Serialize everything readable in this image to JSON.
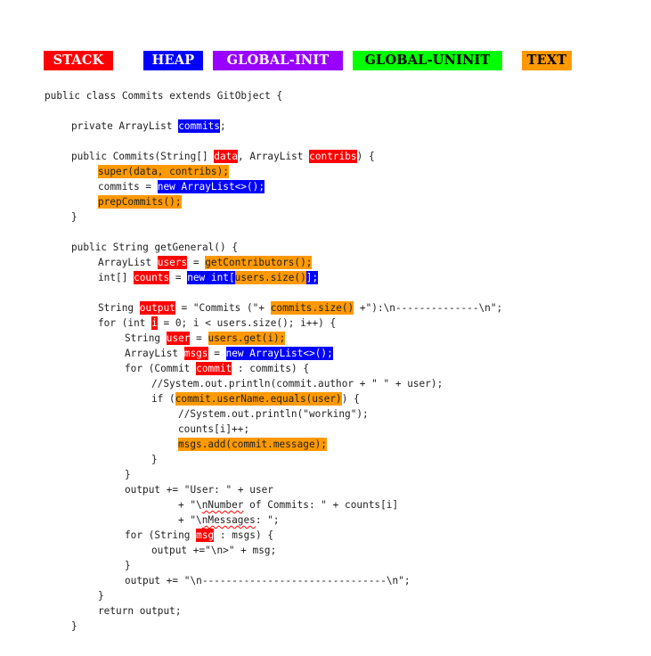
{
  "legend": {
    "stack": {
      "label": "STACK",
      "color": "#ff0000",
      "text_color": "#ffffff"
    },
    "heap": {
      "label": "HEAP",
      "color": "#0000ff",
      "text_color": "#ffffff"
    },
    "global_init": {
      "label": "GLOBAL-INIT",
      "color": "#9900ff",
      "text_color": "#ffffff"
    },
    "global_uninit": {
      "label": "GLOBAL-UNINIT",
      "color": "#00ff00",
      "text_color": "#000000"
    },
    "text": {
      "label": "TEXT",
      "color": "#ff9900",
      "text_color": "#000000"
    }
  },
  "code_lines": [
    {
      "indent": 0,
      "segments": [
        {
          "t": "public class Commits extends GitObject {"
        }
      ]
    },
    {
      "indent": 0,
      "segments": []
    },
    {
      "indent": 1,
      "segments": [
        {
          "t": "private ArrayList "
        },
        {
          "t": "commits",
          "c": "blue"
        },
        {
          "t": ";"
        }
      ]
    },
    {
      "indent": 0,
      "segments": []
    },
    {
      "indent": 1,
      "segments": [
        {
          "t": "public Commits(String[] "
        },
        {
          "t": "data",
          "c": "red"
        },
        {
          "t": ", ArrayList "
        },
        {
          "t": "contribs",
          "c": "red"
        },
        {
          "t": ") {"
        }
      ]
    },
    {
      "indent": 2,
      "segments": [
        {
          "t": "super(data, contribs);",
          "c": "orange"
        }
      ]
    },
    {
      "indent": 2,
      "segments": [
        {
          "t": "commits = "
        },
        {
          "t": "new ArrayList<>();",
          "c": "blue"
        }
      ]
    },
    {
      "indent": 2,
      "segments": [
        {
          "t": "prepCommits();",
          "c": "orange"
        }
      ]
    },
    {
      "indent": 1,
      "segments": [
        {
          "t": "}"
        }
      ]
    },
    {
      "indent": 0,
      "segments": []
    },
    {
      "indent": 1,
      "segments": [
        {
          "t": "public String getGeneral() {"
        }
      ]
    },
    {
      "indent": 2,
      "segments": [
        {
          "t": "ArrayList "
        },
        {
          "t": "users",
          "c": "red"
        },
        {
          "t": " = "
        },
        {
          "t": "getContributors();",
          "c": "orange"
        }
      ]
    },
    {
      "indent": 2,
      "segments": [
        {
          "t": "int[] "
        },
        {
          "t": "counts",
          "c": "red"
        },
        {
          "t": " = "
        },
        {
          "t": "new int[",
          "c": "blue"
        },
        {
          "t": "users.size()",
          "c": "orange"
        },
        {
          "t": "];",
          "c": "blue"
        }
      ]
    },
    {
      "indent": 0,
      "segments": []
    },
    {
      "indent": 2,
      "segments": [
        {
          "t": "String "
        },
        {
          "t": "output",
          "c": "red"
        },
        {
          "t": " = \"Commits (\"+ "
        },
        {
          "t": "commits.size()",
          "c": "orange"
        },
        {
          "t": " +\"):\\n--------------\\n\";"
        }
      ]
    },
    {
      "indent": 2,
      "segments": [
        {
          "t": "for (int "
        },
        {
          "t": "i",
          "c": "red"
        },
        {
          "t": " = 0; i < users.size(); i++) {"
        }
      ]
    },
    {
      "indent": 3,
      "segments": [
        {
          "t": "String "
        },
        {
          "t": "user",
          "c": "red"
        },
        {
          "t": " = "
        },
        {
          "t": "users.get(i);",
          "c": "orange"
        }
      ]
    },
    {
      "indent": 3,
      "segments": [
        {
          "t": "ArrayList "
        },
        {
          "t": "msgs",
          "c": "red"
        },
        {
          "t": " = "
        },
        {
          "t": "new ArrayList<>();",
          "c": "blue"
        }
      ]
    },
    {
      "indent": 3,
      "segments": [
        {
          "t": "for (Commit "
        },
        {
          "t": "commit",
          "c": "red"
        },
        {
          "t": " : commits) {"
        }
      ]
    },
    {
      "indent": 4,
      "segments": [
        {
          "t": "//System.out.println(commit.author + \" \" + user);"
        }
      ]
    },
    {
      "indent": 4,
      "segments": [
        {
          "t": "if ("
        },
        {
          "t": "commit.userName.equals(user)",
          "c": "orange"
        },
        {
          "t": ") {"
        }
      ]
    },
    {
      "indent": 5,
      "segments": [
        {
          "t": "//System.out.println(\"working\");"
        }
      ]
    },
    {
      "indent": 5,
      "segments": [
        {
          "t": "counts[i]++;"
        }
      ]
    },
    {
      "indent": 5,
      "segments": [
        {
          "t": "msgs.add(commit.message);",
          "c": "orange"
        }
      ]
    },
    {
      "indent": 4,
      "segments": [
        {
          "t": "}"
        }
      ]
    },
    {
      "indent": 3,
      "segments": [
        {
          "t": "}"
        }
      ]
    },
    {
      "indent": 3,
      "segments": [
        {
          "t": "output += \"User: \" + user"
        }
      ]
    },
    {
      "indent": 5,
      "segments": [
        {
          "t": "+ \"\\"
        },
        {
          "t": "nNumber",
          "c": "squig"
        },
        {
          "t": " of Commits: \" + counts[i]"
        }
      ]
    },
    {
      "indent": 5,
      "segments": [
        {
          "t": "+ \"\\"
        },
        {
          "t": "nMessages",
          "c": "squig"
        },
        {
          "t": ": \";"
        }
      ]
    },
    {
      "indent": 3,
      "segments": [
        {
          "t": "for (String "
        },
        {
          "t": "msg",
          "c": "red"
        },
        {
          "t": " : msgs) {"
        }
      ]
    },
    {
      "indent": 4,
      "segments": [
        {
          "t": "output +=\"\\n>\" + msg;"
        }
      ]
    },
    {
      "indent": 3,
      "segments": [
        {
          "t": "}"
        }
      ]
    },
    {
      "indent": 3,
      "segments": [
        {
          "t": "output += \"\\n-------------------------------\\n\";"
        }
      ]
    },
    {
      "indent": 2,
      "segments": [
        {
          "t": "}"
        }
      ]
    },
    {
      "indent": 2,
      "segments": [
        {
          "t": "return output;"
        }
      ]
    },
    {
      "indent": 1,
      "segments": [
        {
          "t": "}"
        }
      ]
    }
  ]
}
